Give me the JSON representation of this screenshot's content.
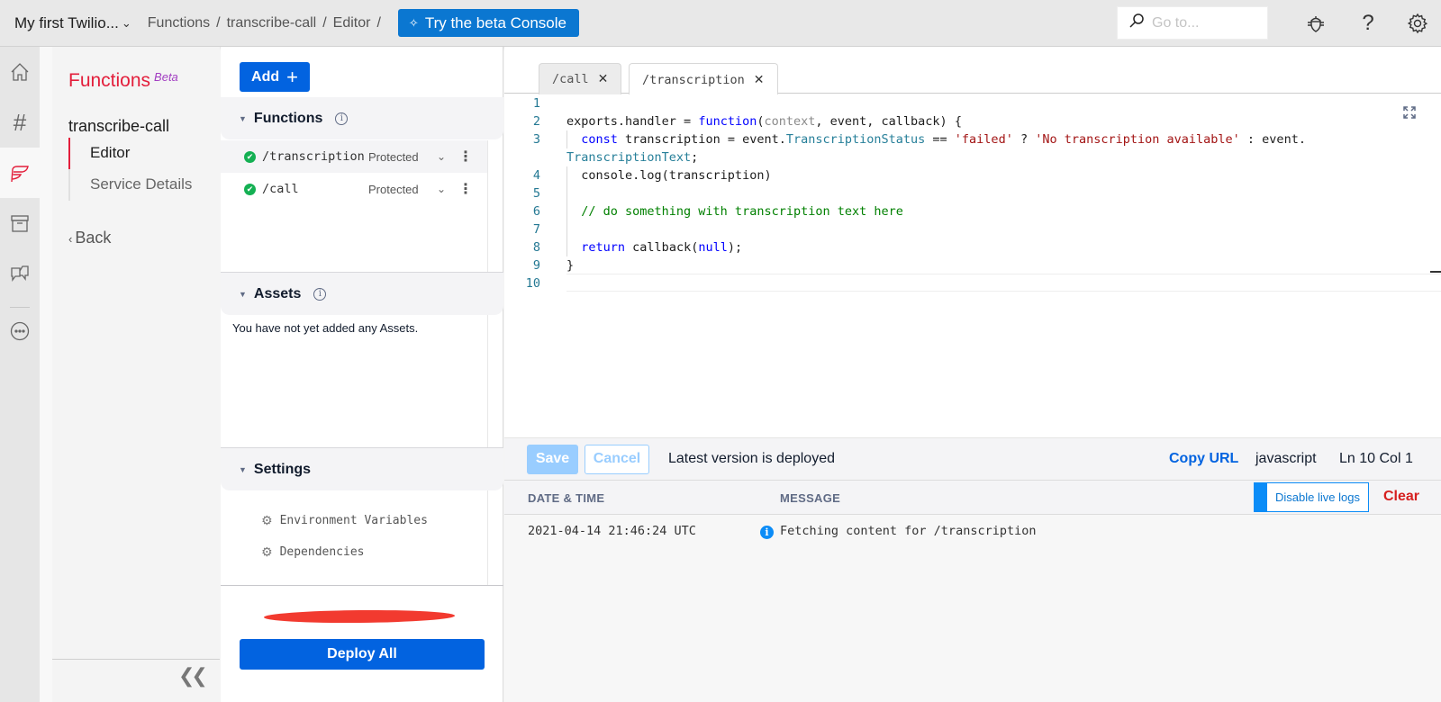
{
  "topbar": {
    "account": "My first Twilio...",
    "breadcrumbs": [
      "Functions",
      "transcribe-call",
      "Editor"
    ],
    "beta_button": "Try the beta Console",
    "search_placeholder": "Go to...",
    "icons": [
      "bug-icon",
      "help-icon",
      "settings-gear-icon"
    ]
  },
  "rail": {
    "items": [
      "home-icon",
      "hash-icon",
      "functions-icon",
      "archive-icon",
      "conversations-icon",
      "more-icon"
    ],
    "active": "functions-icon"
  },
  "section_nav": {
    "title": "Functions",
    "badge": "Beta",
    "service": "transcribe-call",
    "items": [
      {
        "label": "Editor",
        "active": true
      },
      {
        "label": "Service Details",
        "active": false
      }
    ],
    "back_label": "Back"
  },
  "resources": {
    "add_label": "Add",
    "functions_header": "Functions",
    "functions": [
      {
        "path": "/transcription",
        "visibility": "Protected",
        "status": "deployed",
        "selected": true
      },
      {
        "path": "/call",
        "visibility": "Protected",
        "status": "deployed",
        "selected": false
      }
    ],
    "assets_header": "Assets",
    "assets_empty": "You have not yet added any Assets.",
    "settings_header": "Settings",
    "settings": [
      "Environment Variables",
      "Dependencies"
    ],
    "deploy_label": "Deploy All"
  },
  "editor": {
    "tabs": [
      {
        "label": "/call",
        "active": false
      },
      {
        "label": "/transcription",
        "active": true
      }
    ],
    "line_numbers": [
      "1",
      "2",
      "3",
      "",
      "4",
      "5",
      "6",
      "7",
      "8",
      "9",
      "10"
    ],
    "code": {
      "l2a": "exports.handler = ",
      "l2b": "function",
      "l2c": "(",
      "l2d": "context",
      "l2e": ", event, callback) {",
      "l3a": "  ",
      "l3b": "const",
      "l3c": " transcription = event.",
      "l3d": "TranscriptionStatus",
      "l3e": " == ",
      "l3f": "'failed'",
      "l3g": " ? ",
      "l3h": "'No transcription available'",
      "l3i": " : event.",
      "l3w": "TranscriptionText",
      "l3x": ";",
      "l4": "  console.log(transcription)",
      "l6": "  // do something with transcription text here",
      "l8a": "  ",
      "l8b": "return",
      "l8c": " callback(",
      "l8d": "null",
      "l8e": ");",
      "l9": "}"
    },
    "save_label": "Save",
    "cancel_label": "Cancel",
    "deploy_status": "Latest version is deployed",
    "copy_url_label": "Copy URL",
    "language": "javascript",
    "cursor_position": "Ln 10  Col 1"
  },
  "logs": {
    "col_datetime": "DATE & TIME",
    "col_message": "MESSAGE",
    "disable_live_label": "Disable live logs",
    "clear_label": "Clear",
    "entries": [
      {
        "timestamp": "2021-04-14 21:46:24 UTC",
        "level": "info",
        "message": "Fetching content for /transcription"
      }
    ]
  },
  "colors": {
    "brand_red": "#e31e3b",
    "primary_blue": "#0263e0",
    "beta_blue": "#0b77d1",
    "success_green": "#14b053",
    "clear_red": "#d61f1f"
  }
}
